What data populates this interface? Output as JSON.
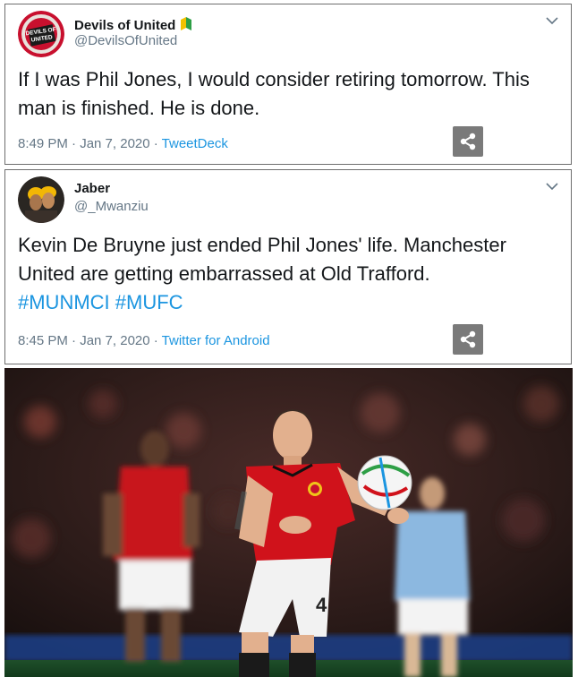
{
  "tweets": [
    {
      "display_name": "Devils of United",
      "handle": "@DevilsOfUnited",
      "text": "If I was Phil Jones, I would consider retiring tomorrow. This man is finished. He is done.",
      "time": "8:49 PM · Jan 7, 2020 · ",
      "source": "TweetDeck",
      "avatar_label": "DEVILS OF UNITED",
      "badge_icon": "beginner-leaf-icon"
    },
    {
      "display_name": "Jaber",
      "handle": "@_Mwanziu",
      "text": "Kevin De Bruyne just ended Phil Jones' life. Manchester United are getting embarrassed at Old Trafford.",
      "hashtags": "#MUNMCI #MUFC",
      "time": "8:45 PM · Jan 7, 2020 · ",
      "source": "Twitter for Android"
    }
  ],
  "photo": {
    "player_number": "4"
  },
  "colors": {
    "link": "#1b95e0",
    "text": "#14171a",
    "meta": "#657786",
    "united_red": "#d0121b"
  }
}
